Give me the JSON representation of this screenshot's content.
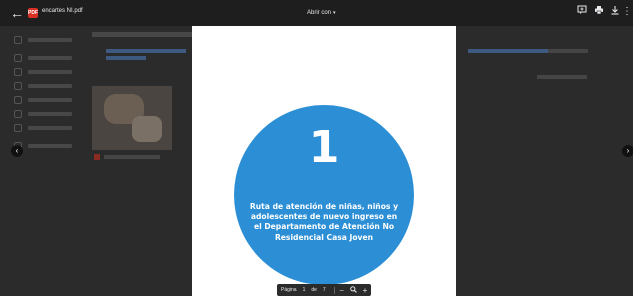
{
  "viewer": {
    "file_name": "encartes NI.pdf",
    "pdf_badge": "PDF",
    "open_with": "Abrir con",
    "icons": [
      "back-arrow-icon",
      "comment-icon",
      "print-icon",
      "download-icon",
      "more-vert-icon"
    ]
  },
  "document": {
    "number": "1",
    "text": "Ruta de atención de niñas, niños y adolescentes de nuevo ingreso en el Departamento de Atención No Residencial Casa Joven",
    "circle_color": "#2c8fd6"
  },
  "pager": {
    "label": "Página",
    "current": "1",
    "of": "de",
    "total": "7"
  },
  "colors": {
    "topbar": "#1e1e1e",
    "backdrop": "#2b2b2b",
    "page": "#ffffff"
  }
}
